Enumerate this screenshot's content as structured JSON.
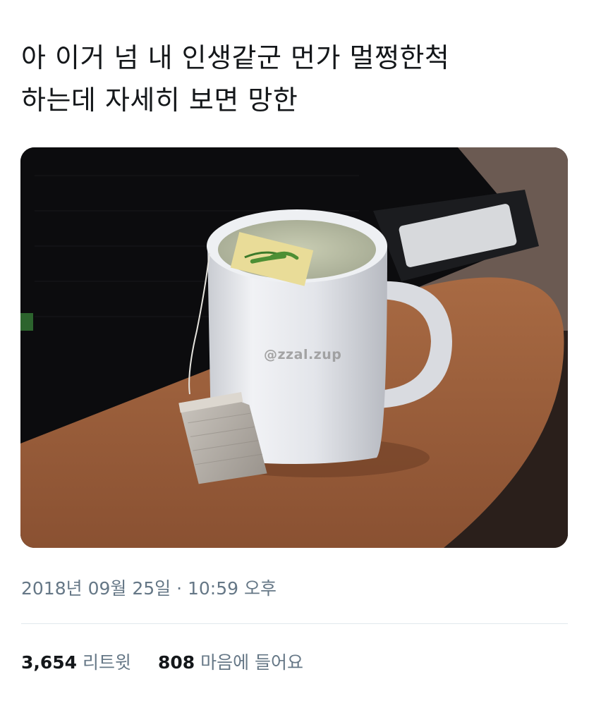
{
  "tweet": {
    "text": "아 이거 넘 내 인생같군 먼가 멀쩡한척\n하는데 자세히 보면 망한",
    "image_watermark": "@zzal.zup",
    "image_description_icon": "tea-mug-photo",
    "timestamp": {
      "date": "2018년 09월 25일",
      "separator": "·",
      "time": "10:59 오후"
    },
    "stats": {
      "retweets_count": "3,654",
      "retweets_label": "리트윗",
      "likes_count": "808",
      "likes_label": "마음에 들어요"
    }
  },
  "colors": {
    "text_primary": "#14171a",
    "text_secondary": "#657786",
    "divider": "#e1e8ed"
  }
}
